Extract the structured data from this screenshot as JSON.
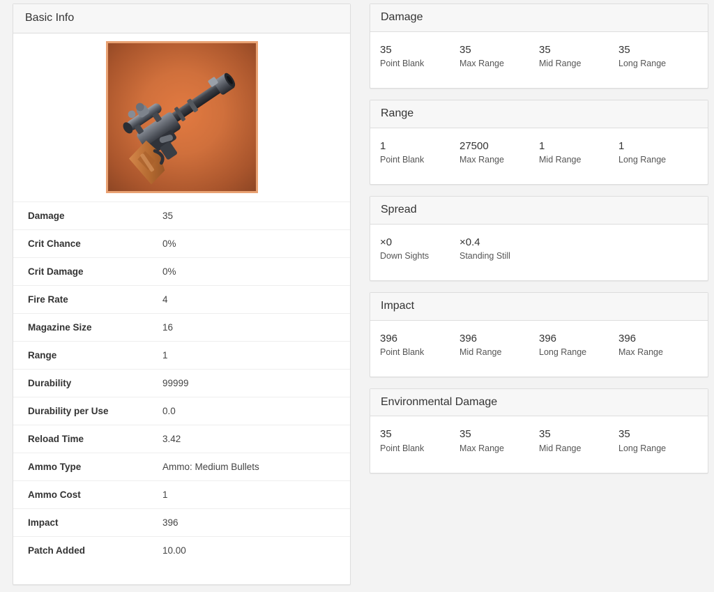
{
  "basic_info": {
    "title": "Basic Info",
    "weapon_image": {
      "icon_name": "sniper-rifle-icon",
      "rarity_color": "#d0703c",
      "frame_color": "#e9a273"
    },
    "rows": [
      {
        "label": "Damage",
        "value": "35"
      },
      {
        "label": "Crit Chance",
        "value": "0%"
      },
      {
        "label": "Crit Damage",
        "value": "0%"
      },
      {
        "label": "Fire Rate",
        "value": "4"
      },
      {
        "label": "Magazine Size",
        "value": "16"
      },
      {
        "label": "Range",
        "value": "1"
      },
      {
        "label": "Durability",
        "value": "99999"
      },
      {
        "label": "Durability per Use",
        "value": "0.0"
      },
      {
        "label": "Reload Time",
        "value": "3.42"
      },
      {
        "label": "Ammo Type",
        "value": "Ammo: Medium Bullets"
      },
      {
        "label": "Ammo Cost",
        "value": "1"
      },
      {
        "label": "Impact",
        "value": "396"
      },
      {
        "label": "Patch Added",
        "value": "10.00"
      }
    ]
  },
  "cards": [
    {
      "title": "Damage",
      "cells": [
        {
          "value": "35",
          "label": "Point Blank"
        },
        {
          "value": "35",
          "label": "Max Range"
        },
        {
          "value": "35",
          "label": "Mid Range"
        },
        {
          "value": "35",
          "label": "Long Range"
        }
      ]
    },
    {
      "title": "Range",
      "cells": [
        {
          "value": "1",
          "label": "Point Blank"
        },
        {
          "value": "27500",
          "label": "Max Range"
        },
        {
          "value": "1",
          "label": "Mid Range"
        },
        {
          "value": "1",
          "label": "Long Range"
        }
      ]
    },
    {
      "title": "Spread",
      "cells": [
        {
          "value": "×0",
          "label": "Down Sights"
        },
        {
          "value": "×0.4",
          "label": "Standing Still"
        }
      ]
    },
    {
      "title": "Impact",
      "cells": [
        {
          "value": "396",
          "label": "Point Blank"
        },
        {
          "value": "396",
          "label": "Mid Range"
        },
        {
          "value": "396",
          "label": "Long Range"
        },
        {
          "value": "396",
          "label": "Max Range"
        }
      ]
    },
    {
      "title": "Environmental Damage",
      "cells": [
        {
          "value": "35",
          "label": "Point Blank"
        },
        {
          "value": "35",
          "label": "Max Range"
        },
        {
          "value": "35",
          "label": "Mid Range"
        },
        {
          "value": "35",
          "label": "Long Range"
        }
      ]
    }
  ]
}
